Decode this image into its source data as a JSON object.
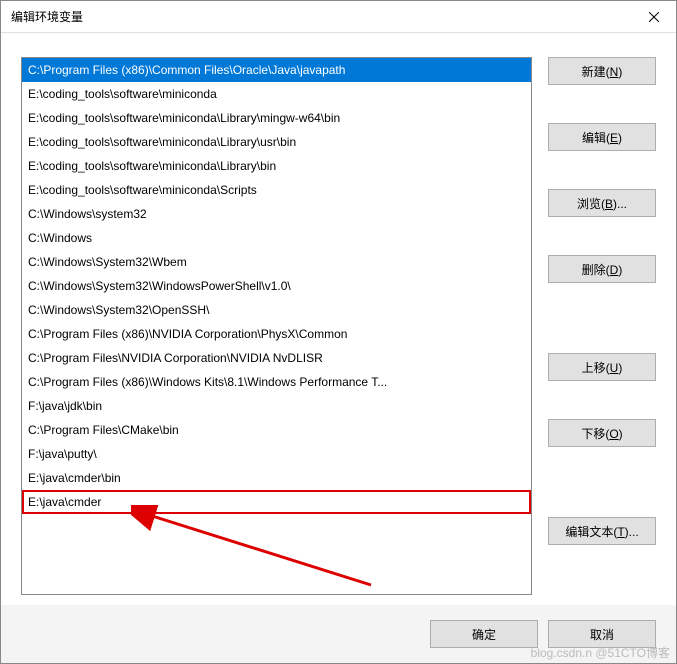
{
  "window": {
    "title": "编辑环境变量"
  },
  "list": {
    "items": [
      "C:\\Program Files (x86)\\Common Files\\Oracle\\Java\\javapath",
      "E:\\coding_tools\\software\\miniconda",
      "E:\\coding_tools\\software\\miniconda\\Library\\mingw-w64\\bin",
      "E:\\coding_tools\\software\\miniconda\\Library\\usr\\bin",
      "E:\\coding_tools\\software\\miniconda\\Library\\bin",
      "E:\\coding_tools\\software\\miniconda\\Scripts",
      "C:\\Windows\\system32",
      "C:\\Windows",
      "C:\\Windows\\System32\\Wbem",
      "C:\\Windows\\System32\\WindowsPowerShell\\v1.0\\",
      "C:\\Windows\\System32\\OpenSSH\\",
      "C:\\Program Files (x86)\\NVIDIA Corporation\\PhysX\\Common",
      "C:\\Program Files\\NVIDIA Corporation\\NVIDIA NvDLISR",
      "C:\\Program Files (x86)\\Windows Kits\\8.1\\Windows Performance T...",
      "F:\\java\\jdk\\bin",
      "C:\\Program Files\\CMake\\bin",
      "F:\\java\\putty\\",
      "E:\\java\\cmder\\bin",
      "E:\\java\\cmder"
    ],
    "selected_index": 0,
    "highlighted_index": 18
  },
  "buttons": {
    "new_label": "新建",
    "new_ak": "N",
    "edit_label": "编辑",
    "edit_ak": "E",
    "browse_label": "浏览",
    "browse_ak": "B",
    "delete_label": "删除",
    "delete_ak": "D",
    "moveup_label": "上移",
    "moveup_ak": "U",
    "movedown_label": "下移",
    "movedown_ak": "O",
    "edittext_label": "编辑文本",
    "edittext_ak": "T",
    "ok_label": "确定",
    "cancel_label": "取消"
  },
  "watermark": "blog.csdn.n @51CTO博客"
}
